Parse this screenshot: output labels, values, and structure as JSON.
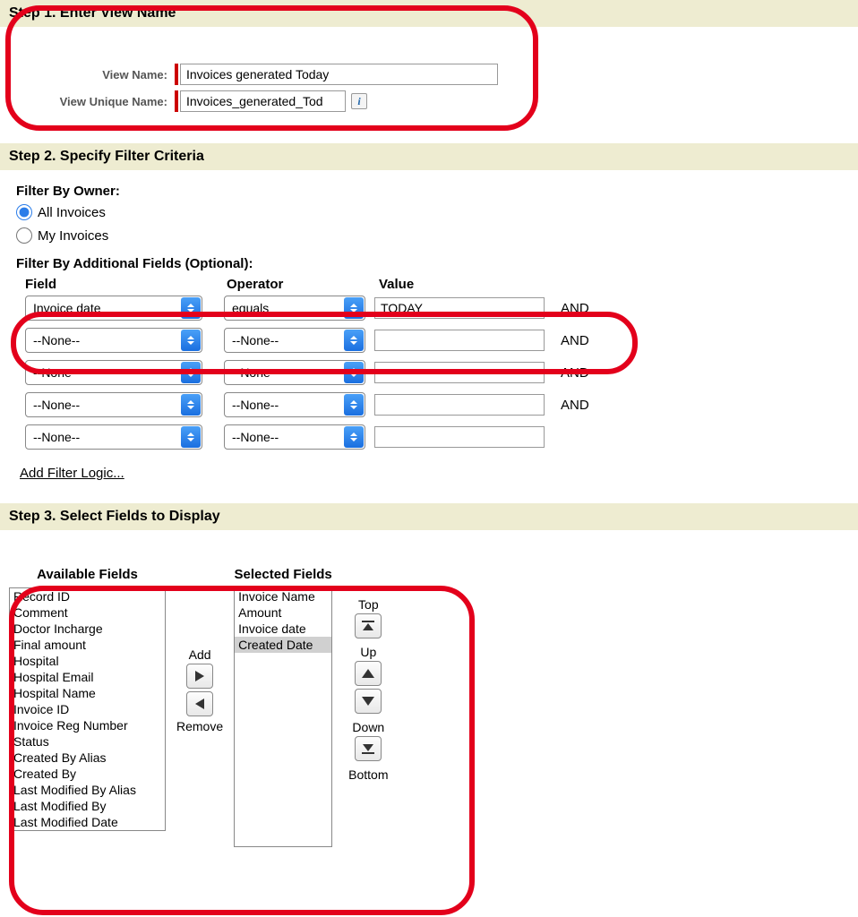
{
  "step1": {
    "title": "Step 1. Enter View Name",
    "viewNameLabel": "View Name:",
    "viewNameValue": "Invoices generated Today",
    "viewUniqueLabel": "View Unique Name:",
    "viewUniqueValue": "Invoices_generated_Tod"
  },
  "step2": {
    "title": "Step 2. Specify Filter Criteria",
    "filterByOwnerLabel": "Filter By Owner:",
    "ownerAll": "All Invoices",
    "ownerMy": "My Invoices",
    "additionalLabel": "Filter By Additional Fields (Optional):",
    "headField": "Field",
    "headOperator": "Operator",
    "headValue": "Value",
    "rows": [
      {
        "field": "Invoice date",
        "operator": "equals",
        "value": "TODAY",
        "and": "AND"
      },
      {
        "field": "--None--",
        "operator": "--None--",
        "value": "",
        "and": "AND"
      },
      {
        "field": "--None--",
        "operator": "--None--",
        "value": "",
        "and": "AND"
      },
      {
        "field": "--None--",
        "operator": "--None--",
        "value": "",
        "and": "AND"
      },
      {
        "field": "--None--",
        "operator": "--None--",
        "value": "",
        "and": ""
      }
    ],
    "addFilterLogic": "Add Filter Logic..."
  },
  "step3": {
    "title": "Step 3. Select Fields to Display",
    "availableLabel": "Available Fields",
    "selectedLabel": "Selected Fields",
    "addLabel": "Add",
    "removeLabel": "Remove",
    "topLabel": "Top",
    "upLabel": "Up",
    "downLabel": "Down",
    "bottomLabel": "Bottom",
    "available": [
      "Record ID",
      "Comment",
      "Doctor Incharge",
      "Final amount",
      "Hospital",
      "Hospital Email",
      "Hospital Name",
      "Invoice ID",
      "Invoice Reg Number",
      "Status",
      "Created By Alias",
      "Created By",
      "Last Modified By Alias",
      "Last Modified By",
      "Last Modified Date"
    ],
    "selected": [
      "Invoice Name",
      "Amount",
      "Invoice date",
      "Created Date"
    ],
    "selectedHighlight": "Created Date"
  }
}
